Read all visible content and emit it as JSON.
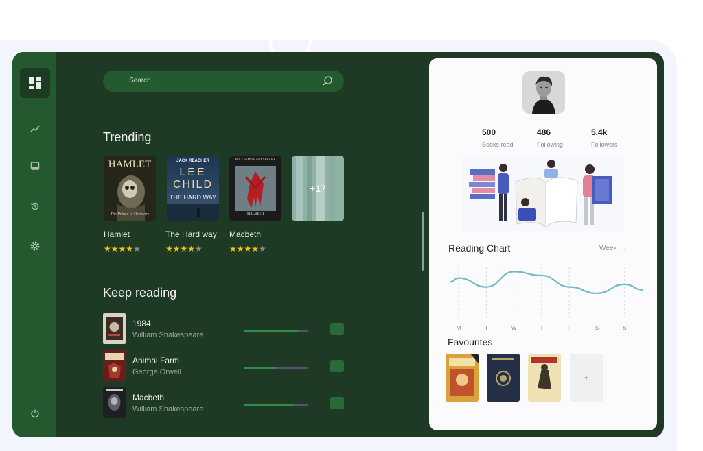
{
  "search": {
    "placeholder": "Search..."
  },
  "sidebar": {
    "items": [
      {
        "icon": "dashboard-icon",
        "active": true
      },
      {
        "icon": "trend-icon"
      },
      {
        "icon": "inbox-icon"
      },
      {
        "icon": "history-icon"
      },
      {
        "icon": "gear-icon"
      },
      {
        "icon": "power-icon"
      }
    ]
  },
  "trending": {
    "title": "Trending",
    "books": [
      {
        "title": "Hamlet",
        "rating": 4,
        "cover_text": "HAMLET",
        "cover_subtext": "The Prince of Denmark"
      },
      {
        "title": "The Hard way",
        "rating": 4,
        "cover_author": "JACK REACHER",
        "cover_line1": "LEE",
        "cover_line2": "CHILD",
        "cover_line3": "THE HARD WAY"
      },
      {
        "title": "Macbeth",
        "rating": 4,
        "cover_text": "WILLIAM SHAKESPEARE",
        "cover_subtext": "MACBETH"
      }
    ],
    "more_count": "+17"
  },
  "keep_reading": {
    "title": "Keep reading",
    "items": [
      {
        "title": "1984",
        "author": "William Shakespeare",
        "progress": 0.86
      },
      {
        "title": "Animal Farm",
        "author": "George Orwell",
        "progress": 0.5
      },
      {
        "title": "Macbeth",
        "author": "William Shakespeare",
        "progress": 0.78
      }
    ],
    "more_label": "···"
  },
  "profile": {
    "stats": [
      {
        "value": "500",
        "label": "Books read"
      },
      {
        "value": "486",
        "label": "Following"
      },
      {
        "value": "5.4k",
        "label": "Followers"
      }
    ]
  },
  "reading_chart": {
    "title": "Reading Chart",
    "period": "Week",
    "days": [
      "M",
      "T",
      "W",
      "T",
      "F",
      "S",
      "S"
    ]
  },
  "chart_data": {
    "type": "line",
    "title": "Reading Chart",
    "categories": [
      "M",
      "T",
      "W",
      "T",
      "F",
      "S",
      "S"
    ],
    "values": [
      3.1,
      2.4,
      3.6,
      3.3,
      2.4,
      1.9,
      2.6
    ],
    "grid": true
  },
  "favourites": {
    "title": "Favourites",
    "add_label": "+"
  },
  "colors": {
    "app_bg": "#1e3a24",
    "sidebar": "#245930",
    "accent_star": "#f2c21c",
    "chart_line": "#6fb9c9"
  }
}
